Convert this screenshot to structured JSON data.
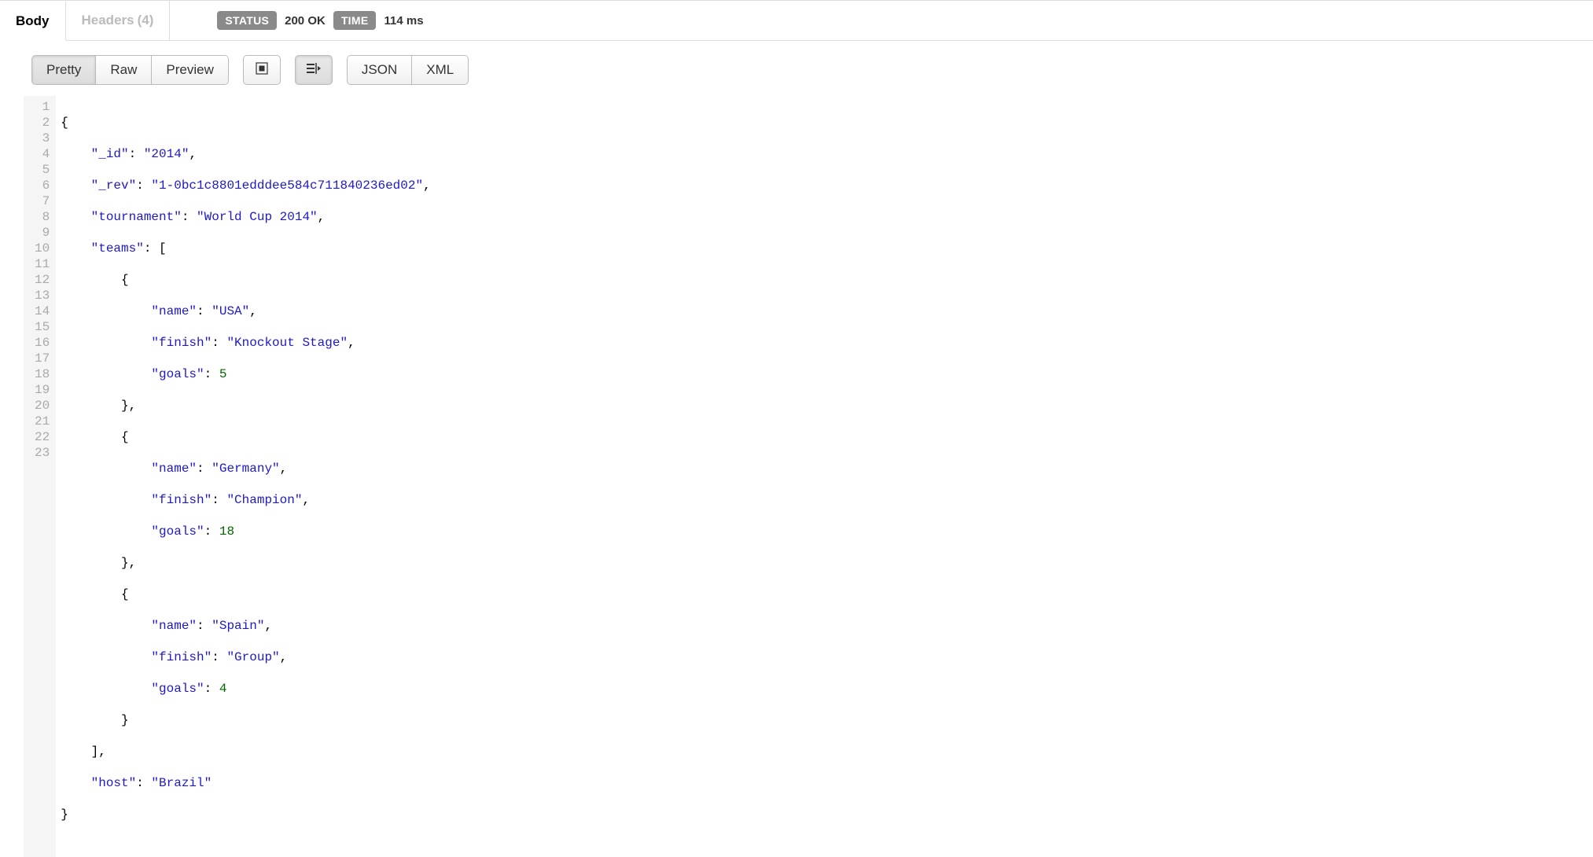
{
  "tabs": {
    "body": "Body",
    "headers_label": "Headers",
    "headers_count": "(4)"
  },
  "status": {
    "status_label": "STATUS",
    "status_value": "200 OK",
    "time_label": "TIME",
    "time_value": "114 ms"
  },
  "toolbar": {
    "pretty": "Pretty",
    "raw": "Raw",
    "preview": "Preview",
    "json": "JSON",
    "xml": "XML"
  },
  "code": {
    "lines": 23,
    "l1": "{",
    "l2a": "    ",
    "l2k": "\"_id\"",
    "l2p1": ": ",
    "l2v": "\"2014\"",
    "l2p2": ",",
    "l3a": "    ",
    "l3k": "\"_rev\"",
    "l3p1": ": ",
    "l3v": "\"1-0bc1c8801edddee584c711840236ed02\"",
    "l3p2": ",",
    "l4a": "    ",
    "l4k": "\"tournament\"",
    "l4p1": ": ",
    "l4v": "\"World Cup 2014\"",
    "l4p2": ",",
    "l5a": "    ",
    "l5k": "\"teams\"",
    "l5p1": ": [",
    "l6": "        {",
    "l7a": "            ",
    "l7k": "\"name\"",
    "l7p1": ": ",
    "l7v": "\"USA\"",
    "l7p2": ",",
    "l8a": "            ",
    "l8k": "\"finish\"",
    "l8p1": ": ",
    "l8v": "\"Knockout Stage\"",
    "l8p2": ",",
    "l9a": "            ",
    "l9k": "\"goals\"",
    "l9p1": ": ",
    "l9v": "5",
    "l10": "        },",
    "l11": "        {",
    "l12a": "            ",
    "l12k": "\"name\"",
    "l12p1": ": ",
    "l12v": "\"Germany\"",
    "l12p2": ",",
    "l13a": "            ",
    "l13k": "\"finish\"",
    "l13p1": ": ",
    "l13v": "\"Champion\"",
    "l13p2": ",",
    "l14a": "            ",
    "l14k": "\"goals\"",
    "l14p1": ": ",
    "l14v": "18",
    "l15": "        },",
    "l16": "        {",
    "l17a": "            ",
    "l17k": "\"name\"",
    "l17p1": ": ",
    "l17v": "\"Spain\"",
    "l17p2": ",",
    "l18a": "            ",
    "l18k": "\"finish\"",
    "l18p1": ": ",
    "l18v": "\"Group\"",
    "l18p2": ",",
    "l19a": "            ",
    "l19k": "\"goals\"",
    "l19p1": ": ",
    "l19v": "4",
    "l20": "        }",
    "l21": "    ],",
    "l22a": "    ",
    "l22k": "\"host\"",
    "l22p1": ": ",
    "l22v": "\"Brazil\"",
    "l23": "}"
  },
  "response_json": {
    "_id": "2014",
    "_rev": "1-0bc1c8801edddee584c711840236ed02",
    "tournament": "World Cup 2014",
    "teams": [
      {
        "name": "USA",
        "finish": "Knockout Stage",
        "goals": 5
      },
      {
        "name": "Germany",
        "finish": "Champion",
        "goals": 18
      },
      {
        "name": "Spain",
        "finish": "Group",
        "goals": 4
      }
    ],
    "host": "Brazil"
  }
}
